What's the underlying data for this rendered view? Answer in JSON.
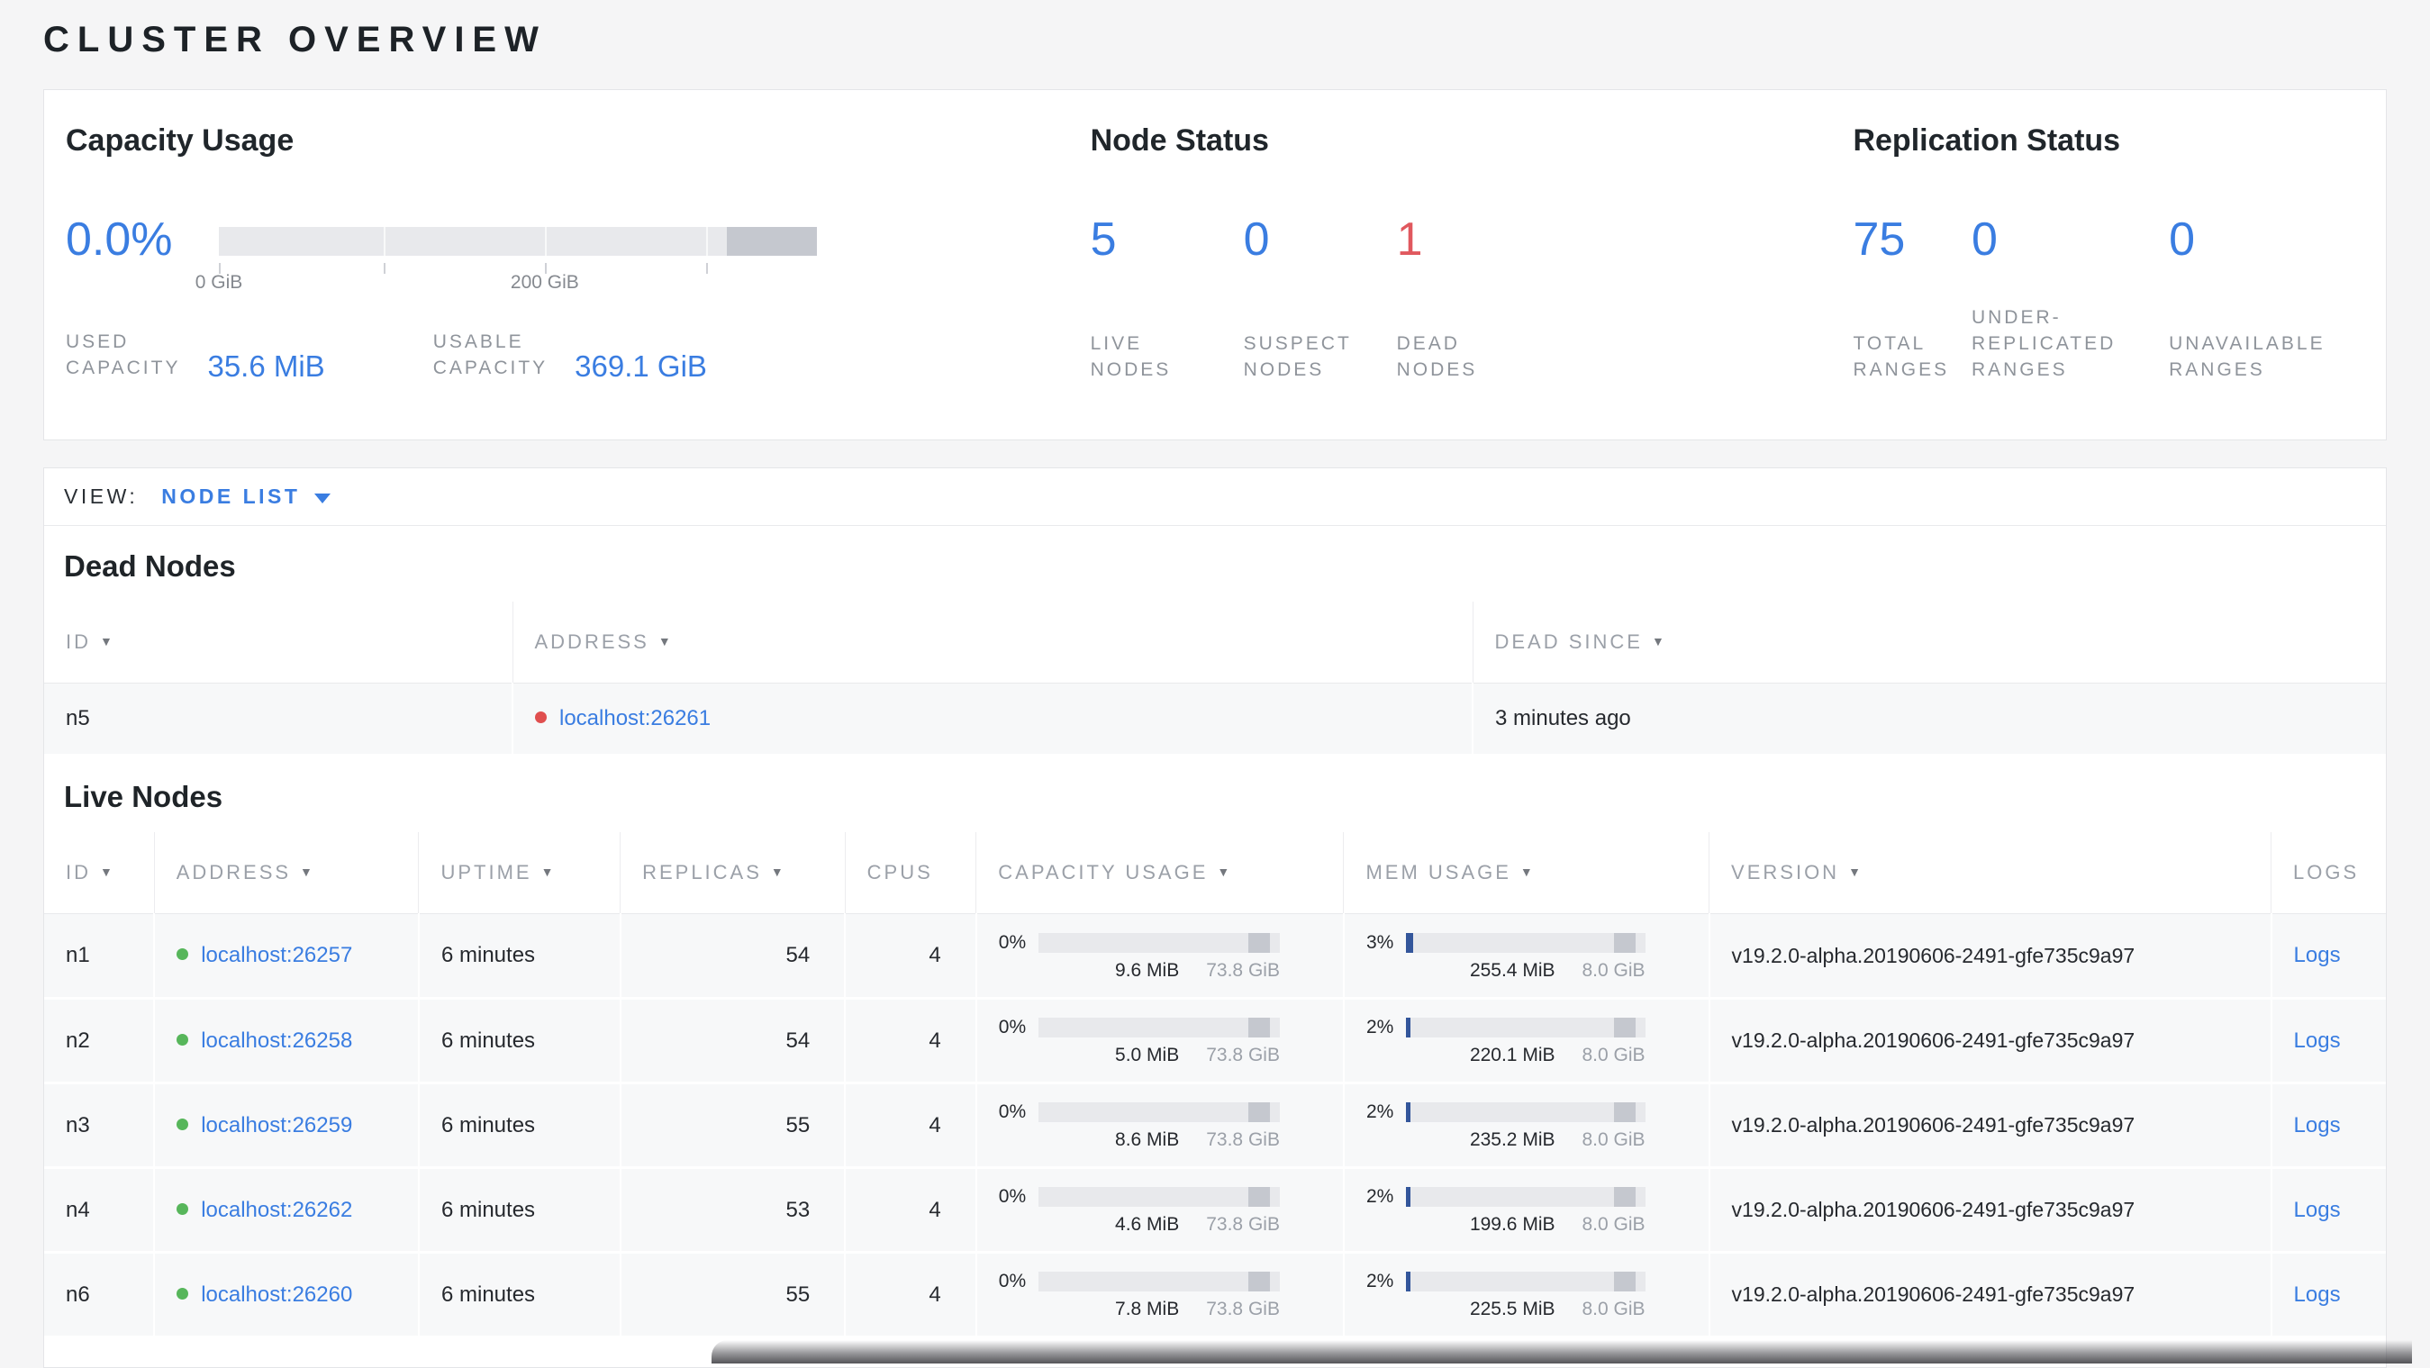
{
  "icons": {
    "sort_arrow": "▼",
    "dropdown_caret": "▼",
    "live_dot": "●",
    "dead_dot": "●"
  },
  "colors": {
    "accent_blue": "#3a7de1",
    "danger_red": "#e0585e",
    "live_green": "#57b65b",
    "dead_red": "#e04f4f"
  },
  "page": {
    "title": "CLUSTER OVERVIEW"
  },
  "summary": {
    "capacity": {
      "title": "Capacity Usage",
      "percent": "0.0%",
      "tick_labels": [
        "0 GiB",
        "200 GiB"
      ],
      "used_label": "USED\nCAPACITY",
      "used_value": "35.6 MiB",
      "usable_label": "USABLE\nCAPACITY",
      "usable_value": "369.1 GiB"
    },
    "node_status": {
      "title": "Node Status",
      "stats": [
        {
          "value": "5",
          "label": "LIVE\nNODES",
          "tone": "blue"
        },
        {
          "value": "0",
          "label": "SUSPECT\nNODES",
          "tone": "blue"
        },
        {
          "value": "1",
          "label": "DEAD\nNODES",
          "tone": "red"
        }
      ]
    },
    "replication": {
      "title": "Replication Status",
      "stats": [
        {
          "value": "75",
          "label": "TOTAL\nRANGES",
          "tone": "blue"
        },
        {
          "value": "0",
          "label": "UNDER-\nREPLICATED\nRANGES",
          "tone": "blue"
        },
        {
          "value": "0",
          "label": "UNAVAILABLE\nRANGES",
          "tone": "blue"
        }
      ]
    }
  },
  "view_bar": {
    "label": "VIEW:",
    "selected": "NODE LIST"
  },
  "dead_nodes": {
    "title": "Dead Nodes",
    "columns": [
      {
        "key": "id",
        "label": "ID",
        "sort": true
      },
      {
        "key": "address",
        "label": "ADDRESS",
        "sort": true
      },
      {
        "key": "dead_since",
        "label": "DEAD SINCE",
        "sort": true
      }
    ],
    "rows": [
      {
        "id": "n5",
        "address": "localhost:26261",
        "dead_since": "3 minutes ago"
      }
    ]
  },
  "live_nodes": {
    "title": "Live Nodes",
    "columns": [
      {
        "key": "id",
        "label": "ID",
        "sort": true
      },
      {
        "key": "address",
        "label": "ADDRESS",
        "sort": true
      },
      {
        "key": "uptime",
        "label": "UPTIME",
        "sort": true
      },
      {
        "key": "replicas",
        "label": "REPLICAS",
        "sort": true
      },
      {
        "key": "cpus",
        "label": "CPUS",
        "sort": false
      },
      {
        "key": "capacity",
        "label": "CAPACITY USAGE",
        "sort": true
      },
      {
        "key": "mem",
        "label": "MEM USAGE",
        "sort": true
      },
      {
        "key": "version",
        "label": "VERSION",
        "sort": true
      },
      {
        "key": "logs",
        "label": "LOGS",
        "sort": false
      }
    ],
    "rows": [
      {
        "id": "n1",
        "address": "localhost:26257",
        "uptime": "6 minutes",
        "replicas": "54",
        "cpus": "4",
        "capacity": {
          "percent": "0%",
          "percent_num": 0,
          "used": "9.6 MiB",
          "total": "73.8 GiB"
        },
        "mem": {
          "percent": "3%",
          "percent_num": 3,
          "used": "255.4 MiB",
          "total": "8.0 GiB"
        },
        "version": "v19.2.0-alpha.20190606-2491-gfe735c9a97",
        "logs": "Logs"
      },
      {
        "id": "n2",
        "address": "localhost:26258",
        "uptime": "6 minutes",
        "replicas": "54",
        "cpus": "4",
        "capacity": {
          "percent": "0%",
          "percent_num": 0,
          "used": "5.0 MiB",
          "total": "73.8 GiB"
        },
        "mem": {
          "percent": "2%",
          "percent_num": 2,
          "used": "220.1 MiB",
          "total": "8.0 GiB"
        },
        "version": "v19.2.0-alpha.20190606-2491-gfe735c9a97",
        "logs": "Logs"
      },
      {
        "id": "n3",
        "address": "localhost:26259",
        "uptime": "6 minutes",
        "replicas": "55",
        "cpus": "4",
        "capacity": {
          "percent": "0%",
          "percent_num": 0,
          "used": "8.6 MiB",
          "total": "73.8 GiB"
        },
        "mem": {
          "percent": "2%",
          "percent_num": 2,
          "used": "235.2 MiB",
          "total": "8.0 GiB"
        },
        "version": "v19.2.0-alpha.20190606-2491-gfe735c9a97",
        "logs": "Logs"
      },
      {
        "id": "n4",
        "address": "localhost:26262",
        "uptime": "6 minutes",
        "replicas": "53",
        "cpus": "4",
        "capacity": {
          "percent": "0%",
          "percent_num": 0,
          "used": "4.6 MiB",
          "total": "73.8 GiB"
        },
        "mem": {
          "percent": "2%",
          "percent_num": 2,
          "used": "199.6 MiB",
          "total": "8.0 GiB"
        },
        "version": "v19.2.0-alpha.20190606-2491-gfe735c9a97",
        "logs": "Logs"
      },
      {
        "id": "n6",
        "address": "localhost:26260",
        "uptime": "6 minutes",
        "replicas": "55",
        "cpus": "4",
        "capacity": {
          "percent": "0%",
          "percent_num": 0,
          "used": "7.8 MiB",
          "total": "73.8 GiB"
        },
        "mem": {
          "percent": "2%",
          "percent_num": 2,
          "used": "225.5 MiB",
          "total": "8.0 GiB"
        },
        "version": "v19.2.0-alpha.20190606-2491-gfe735c9a97",
        "logs": "Logs"
      }
    ]
  }
}
